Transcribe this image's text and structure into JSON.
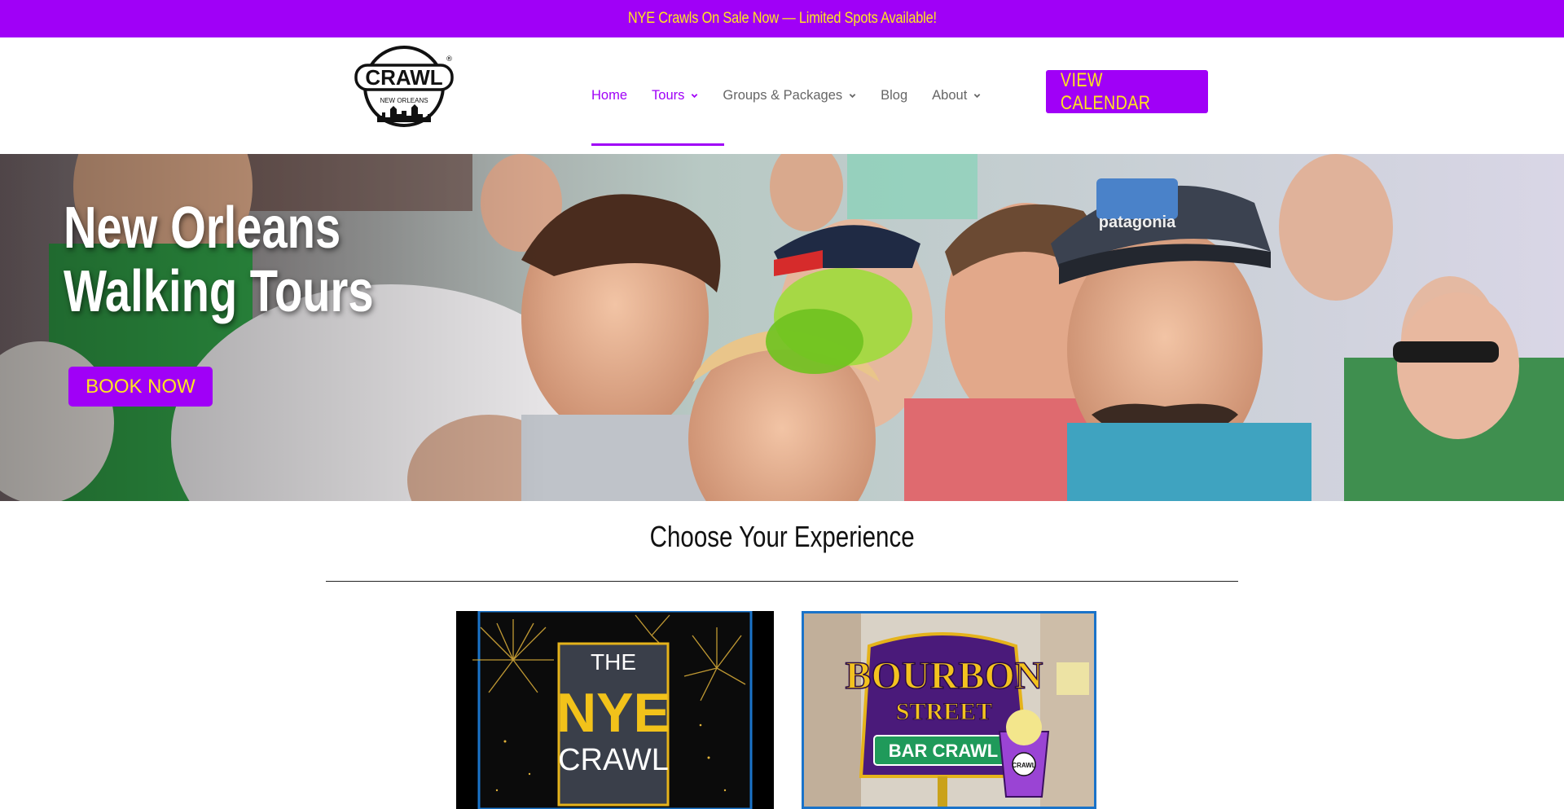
{
  "announcement": {
    "text": "NYE Crawls On Sale Now — Limited Spots Available!"
  },
  "logo": {
    "wordmark": "CRAWL",
    "sub": "NEW ORLEANS",
    "registered": "®"
  },
  "nav": {
    "items": [
      {
        "label": "Home",
        "active": true,
        "dropdown": false
      },
      {
        "label": "Tours",
        "active": true,
        "dropdown": true
      },
      {
        "label": "Groups & Packages",
        "active": false,
        "dropdown": true
      },
      {
        "label": "Blog",
        "active": false,
        "dropdown": false
      },
      {
        "label": "About",
        "active": false,
        "dropdown": true
      }
    ],
    "cta_label": "VIEW CALENDAR"
  },
  "hero": {
    "title_line1": "New Orleans",
    "title_line2": "Walking Tours",
    "book_label": "BOOK NOW",
    "hat_text": "patagonia"
  },
  "experience": {
    "heading": "Choose Your Experience",
    "cards": [
      {
        "poster_top": "THE",
        "poster_main": "NYE",
        "poster_bottom": "CRAWL"
      },
      {
        "poster_line1": "BOURBON",
        "poster_line2": "STREET",
        "poster_line3": "BAR CRAWL",
        "cup_text": "CRAWL"
      }
    ]
  },
  "colors": {
    "brand_purple": "#a000f7",
    "brand_yellow": "#ffe51f",
    "card_border_blue": "#1a73c9"
  }
}
